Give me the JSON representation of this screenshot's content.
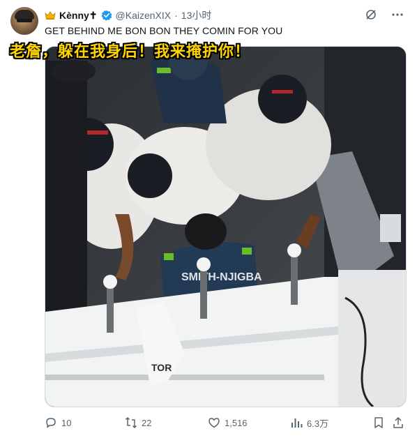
{
  "author": {
    "display_name": "Kènny✝",
    "handle": "@KaizenXIX",
    "separator": "·",
    "time": "13小时"
  },
  "tweet": {
    "text": "GET BEHIND ME BON BON THEY COMIN FOR YOU"
  },
  "media": {
    "subtitle_overlay": "老詹，躲在我身后！我来掩护你！",
    "jersey_text": "SMITH-NJIGBA",
    "towel_text": "TOR"
  },
  "actions": {
    "replies": "10",
    "retweets": "22",
    "likes": "1,516",
    "views": "6.3万"
  },
  "colors": {
    "verified": "#1d9bf0",
    "subtitle": "#ffd400",
    "muted": "#536471"
  }
}
